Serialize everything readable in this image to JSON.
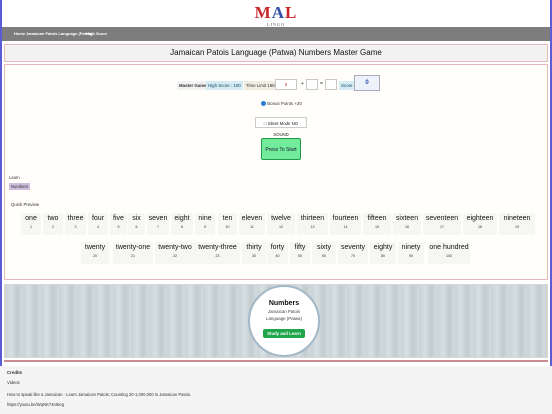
{
  "logo": {
    "text_m": "M",
    "text_a": "A",
    "text_l": "L",
    "subtitle": "LINGO"
  },
  "nav": {
    "items": [
      "Home",
      "Jamaican Patois Language (Patwa)",
      "High Score"
    ]
  },
  "page_title": "Jamaican Patois Language (Patwa) Numbers Master Game",
  "game": {
    "master_game_label": "Master Game",
    "high_score_label": "High Score : 100",
    "time_limit_label": "Time Limit 1800",
    "time_value": "0",
    "plus_sign": "+",
    "equals_sign": "=",
    "score_label": "Score",
    "score_value": "0",
    "bonus_label": "Bonus Points +20",
    "silent_mode_label": "Silent Mode NO SOUND",
    "start_button_label": "Press To Start"
  },
  "learn": {
    "label": "Learn",
    "numbers_tag": "Numbers"
  },
  "quick_preview": {
    "label": "Quick Preview",
    "row1": [
      {
        "word": "one",
        "num": "1"
      },
      {
        "word": "two",
        "num": "2"
      },
      {
        "word": "three",
        "num": "3"
      },
      {
        "word": "four",
        "num": "4"
      },
      {
        "word": "five",
        "num": "5"
      },
      {
        "word": "six",
        "num": "6"
      },
      {
        "word": "seven",
        "num": "7"
      },
      {
        "word": "eight",
        "num": "8"
      },
      {
        "word": "nine",
        "num": "9"
      },
      {
        "word": "ten",
        "num": "10"
      },
      {
        "word": "eleven",
        "num": "11"
      },
      {
        "word": "twelve",
        "num": "12"
      },
      {
        "word": "thirteen",
        "num": "13"
      },
      {
        "word": "fourteen",
        "num": "14"
      },
      {
        "word": "fifteen",
        "num": "15"
      },
      {
        "word": "sixteen",
        "num": "16"
      },
      {
        "word": "seventeen",
        "num": "17"
      },
      {
        "word": "eighteen",
        "num": "18"
      },
      {
        "word": "nineteen",
        "num": "19"
      }
    ],
    "row2": [
      {
        "word": "twenty",
        "num": "20"
      },
      {
        "word": "twenty-one",
        "num": "21"
      },
      {
        "word": "twenty-two",
        "num": "22"
      },
      {
        "word": "twenty-three",
        "num": "23"
      },
      {
        "word": "thirty",
        "num": "30"
      },
      {
        "word": "forty",
        "num": "40"
      },
      {
        "word": "fifty",
        "num": "50"
      },
      {
        "word": "sixty",
        "num": "60"
      },
      {
        "word": "seventy",
        "num": "70"
      },
      {
        "word": "eighty",
        "num": "80"
      },
      {
        "word": "ninety",
        "num": "90"
      },
      {
        "word": "one hundred",
        "num": "100"
      }
    ]
  },
  "hero": {
    "title": "Numbers",
    "subtitle_line1": "Jamaican Patois",
    "subtitle_line2": "Language (Patwa)",
    "button_label": "Study and Learn"
  },
  "credits": {
    "heading": "Credits",
    "videos_label": "Videos",
    "line1": "How to speak like a Jamaican - Learn Jamaican Patois: Counting 20-1,000,000 in Jamaican Patois.",
    "line2": "https://youtu.be/WqNK74nIbeg"
  }
}
